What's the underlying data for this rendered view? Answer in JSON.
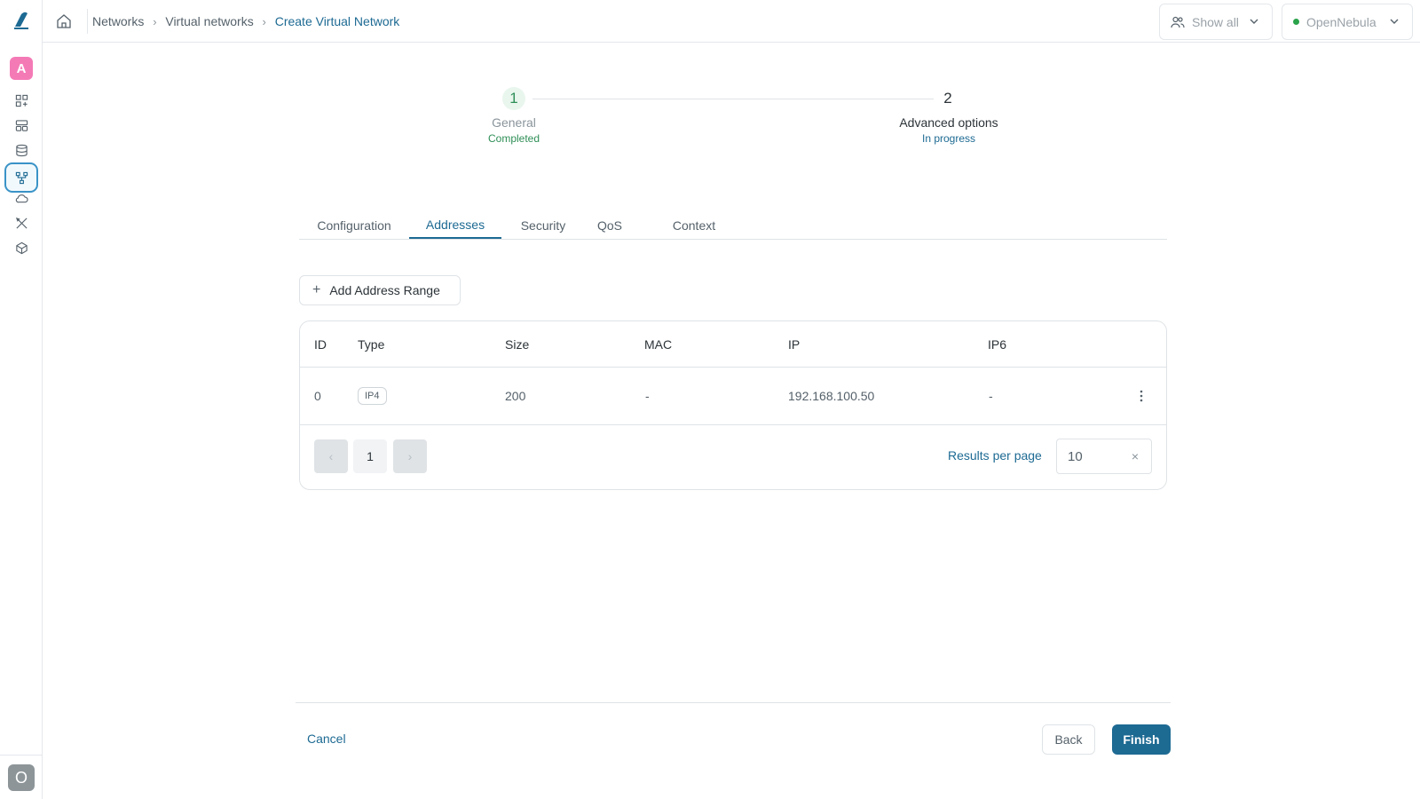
{
  "sidebar": {
    "logo_icon": "opennebula-logo-icon",
    "app_avatar_letter": "A",
    "nav_icons": [
      "dashboard-icon",
      "templates-icon",
      "storage-icon",
      "networks-icon",
      "cloud-icon",
      "tools-icon",
      "infrastructure-icon"
    ],
    "active_nav": "networks-icon",
    "user_avatar_letter": "O"
  },
  "header": {
    "breadcrumbs": [
      "Networks",
      "Virtual networks",
      "Create Virtual Network"
    ],
    "group_selector": "Show all",
    "zone_selector": "OpenNebula"
  },
  "stepper": {
    "steps": [
      {
        "number": "1",
        "title": "General",
        "status": "Completed"
      },
      {
        "number": "2",
        "title": "Advanced options",
        "status": "In progress"
      }
    ]
  },
  "tabs": [
    "Configuration",
    "Addresses",
    "Security",
    "QoS",
    "Context"
  ],
  "active_tab": "Addresses",
  "add_button_label": "Add Address Range",
  "table": {
    "columns": [
      "ID",
      "Type",
      "Size",
      "MAC",
      "IP",
      "IP6"
    ],
    "rows": [
      {
        "id": "0",
        "type": "IP4",
        "size": "200",
        "mac": "-",
        "ip": "192.168.100.50",
        "ip6": "-"
      }
    ]
  },
  "pagination": {
    "prev": "‹",
    "page": "1",
    "next": "›",
    "results_per_page_label": "Results per page",
    "results_per_page_value": "10",
    "clear_icon": "×"
  },
  "footer": {
    "cancel_label": "Cancel",
    "back_label": "Back",
    "finish_label": "Finish"
  },
  "colors": {
    "accent": "#1d6a93",
    "success": "#2f8f57",
    "avatar_pink": "#f47ab6"
  }
}
